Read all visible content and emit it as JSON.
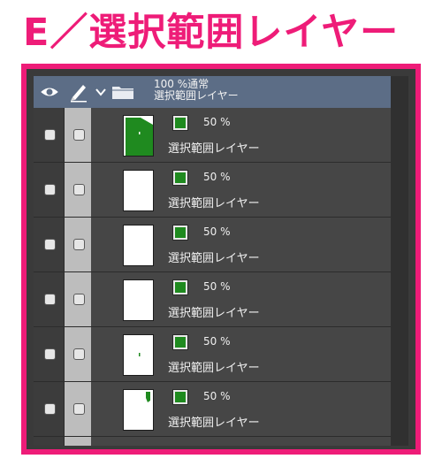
{
  "heading": "E／選択範囲レイヤー",
  "folder": {
    "opacity_mode": "100 %通常",
    "name": "選択範囲レイヤー"
  },
  "layers": [
    {
      "opacity": "50 %",
      "name": "選択範囲レイヤー",
      "thumb": "mostly-green"
    },
    {
      "opacity": "50 %",
      "name": "選択範囲レイヤー",
      "thumb": "blank"
    },
    {
      "opacity": "50 %",
      "name": "選択範囲レイヤー",
      "thumb": "blank"
    },
    {
      "opacity": "50 %",
      "name": "選択範囲レイヤー",
      "thumb": "blank"
    },
    {
      "opacity": "50 %",
      "name": "選択範囲レイヤー",
      "thumb": "green-dot"
    },
    {
      "opacity": "50 %",
      "name": "選択範囲レイヤー",
      "thumb": "green-corner"
    }
  ],
  "colors": {
    "accent": "#ee1c78",
    "header": "#5c6d86",
    "mask_green": "#1f8a1f",
    "panel": "#464646"
  },
  "icons": [
    "eye-icon",
    "pen-icon",
    "chevron-down-icon",
    "folder-icon",
    "layer-mask-icon",
    "checkbox"
  ]
}
